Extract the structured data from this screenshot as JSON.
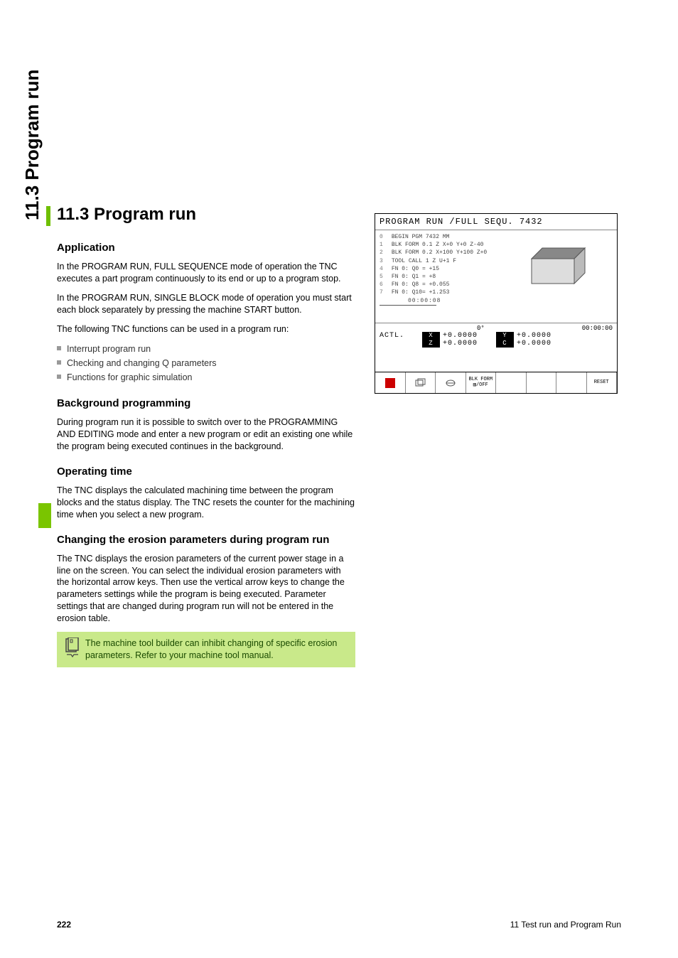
{
  "side": {
    "title": "11.3 Program run"
  },
  "h1": "11.3 Program run",
  "sections": {
    "application": {
      "heading": "Application",
      "p1": "In the PROGRAM RUN, FULL SEQUENCE mode of operation the TNC executes a part program continuously to its end or up to a program stop.",
      "p2": "In the PROGRAM RUN, SINGLE BLOCK mode of operation you must start each block separately by pressing the machine START button.",
      "p3": "The following TNC functions can be used in a program run:",
      "bullets": [
        "Interrupt program run",
        "Checking and changing Q parameters",
        "Functions for graphic simulation"
      ]
    },
    "background": {
      "heading": "Background programming",
      "p1": "During program run it is possible to switch over to the PROGRAMMING AND EDITING mode and enter a new program or edit an existing one while the program being executed continues in the background."
    },
    "optime": {
      "heading": "Operating time",
      "p1": "The TNC displays the calculated machining time between the program blocks and the status display. The TNC resets the counter for the machining time when you select a new program."
    },
    "changing": {
      "heading": "Changing the erosion parameters during program run",
      "p1": "The TNC displays the erosion parameters of the current power stage in a line on the screen. You can select the individual erosion parameters with the horizontal arrow keys. Then use the vertical arrow keys to change the parameters settings while the program is being executed. Parameter settings that are changed during program run will not be entered in the erosion table.",
      "note": "The machine tool builder can inhibit changing of specific erosion parameters. Refer to your machine tool manual."
    }
  },
  "screenshot": {
    "title": "PROGRAM RUN /FULL SEQU. 7432",
    "code": [
      {
        "n": "0",
        "t": "BEGIN PGM 7432 MM"
      },
      {
        "n": "1",
        "t": "BLK FORM 0.1 Z X+0 Y+0 Z-40"
      },
      {
        "n": "2",
        "t": "BLK FORM 0.2 X+100 Y+100 Z+0"
      },
      {
        "n": "3",
        "t": "TOOL CALL 1 Z U+1 F"
      },
      {
        "n": "4",
        "t": "FN 0: Q0 = +15"
      },
      {
        "n": "5",
        "t": "FN 0: Q1 = +8"
      },
      {
        "n": "6",
        "t": "FN 0: Q8 = +0.055"
      },
      {
        "n": "7",
        "t": "FN 0: Q10= +1.253"
      }
    ],
    "time": "00:00:08",
    "status": {
      "angle": "0°",
      "timer": "00:00:00",
      "actl": "ACTL.",
      "x": "+0.0000",
      "z": "+0.0000",
      "y": "+0.0000",
      "c": "+0.0000"
    },
    "softkeys": {
      "blkform": "BLK FORM ▥/OFF",
      "reset": "RESET"
    }
  },
  "footer": {
    "page": "222",
    "chapter": "11 Test run and Program Run"
  }
}
